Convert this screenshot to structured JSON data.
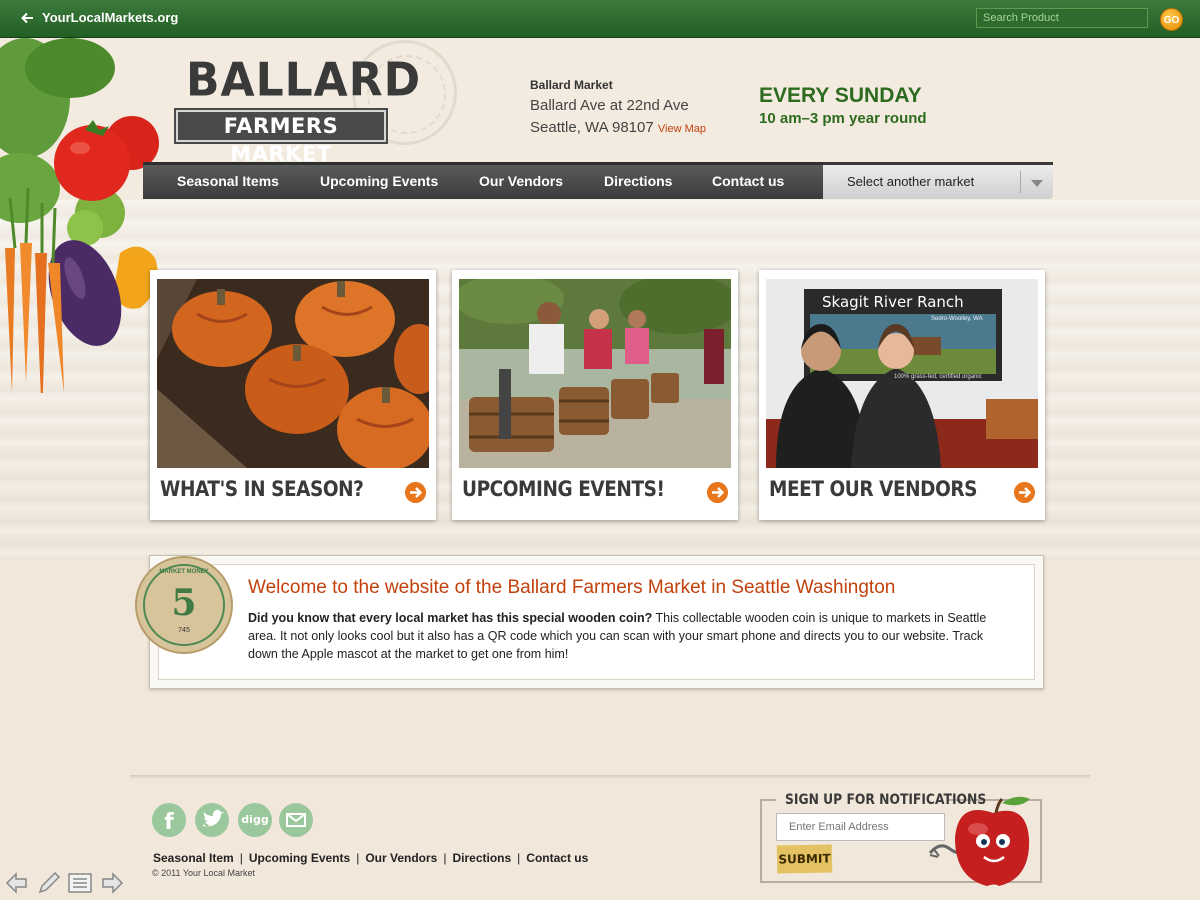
{
  "topbar": {
    "back_label": "YourLocalMarkets.org",
    "search_placeholder": "Search Product",
    "go_label": "GO"
  },
  "logo": {
    "line1": "BALLARD",
    "line2": "FARMERS MARKET"
  },
  "address": {
    "name": "Ballard Market",
    "street": "Ballard Ave at 22nd Ave",
    "city": "Seattle, WA 98107",
    "map_link": "View Map"
  },
  "schedule": {
    "day": "EVERY SUNDAY",
    "hours": "10 am–3 pm year round"
  },
  "nav": {
    "items": [
      {
        "label": "Seasonal Items"
      },
      {
        "label": "Upcoming Events"
      },
      {
        "label": "Our Vendors"
      },
      {
        "label": "Directions"
      },
      {
        "label": "Contact us"
      }
    ],
    "market_select": "Select another market"
  },
  "cards": [
    {
      "title": "WHAT'S IN SEASON?",
      "image": "pumpkins-photo"
    },
    {
      "title": "UPCOMING EVENTS!",
      "image": "grape-stomping-photo"
    },
    {
      "title": "MEET OUR VENDORS",
      "image": "vendors-photo"
    }
  ],
  "vendor_banner": {
    "name": "Skagit River Ranch",
    "subtitle": "Sedro-Woolley, WA",
    "note": "100% grass-fed, certified organic"
  },
  "coin": {
    "value": "5",
    "top_text": "MARKET MONEY",
    "serial": "745"
  },
  "welcome": {
    "heading": "Welcome to the website of the Ballard Farmers Market in Seattle Washington",
    "bold_intro": "Did you know that every local market has this special wooden coin?",
    "body": " This collectable wooden coin is unique to markets in Seattle area. It not only looks cool but it also has a QR code which you can scan with your smart phone and directs you to our website. Track down the Apple mascot at the market to get one from him!"
  },
  "footer": {
    "social": [
      "facebook-icon",
      "twitter-icon",
      "digg-icon",
      "mail-icon"
    ],
    "digg_label": "digg",
    "links": [
      {
        "label": "Seasonal Item"
      },
      {
        "label": "Upcoming Events"
      },
      {
        "label": "Our Vendors"
      },
      {
        "label": "Directions"
      },
      {
        "label": "Contact us"
      }
    ],
    "copyright": "© 2011 Your Local Market"
  },
  "signup": {
    "title": "SIGN UP FOR NOTIFICATIONS",
    "email_placeholder": "Enter Email Address",
    "submit_label": "SUBMIT"
  },
  "colors": {
    "brand_green": "#215f24",
    "accent_orange": "#e8761c",
    "heading_red": "#c2410c",
    "nav_gray": "#3c3c3c"
  }
}
